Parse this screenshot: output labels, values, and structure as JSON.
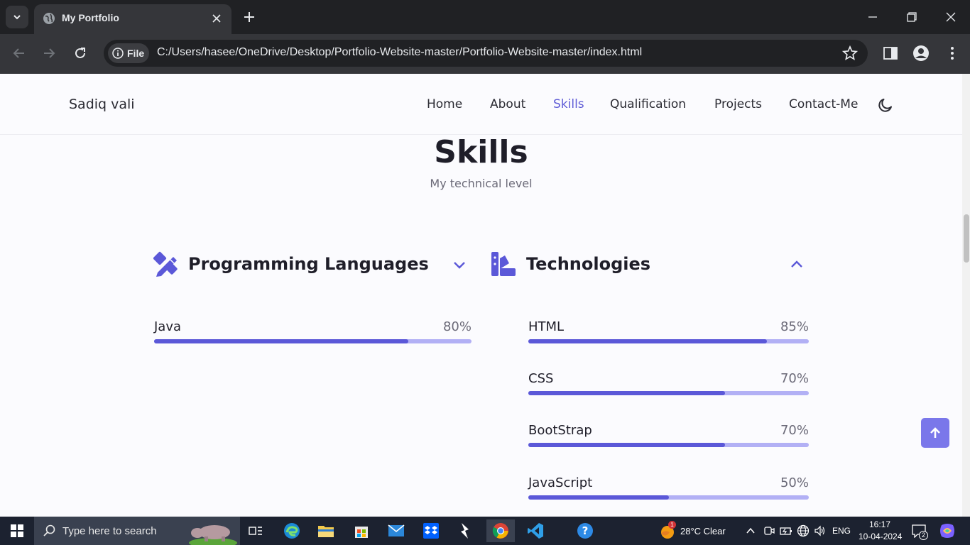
{
  "browser": {
    "tab_title": "My Portfolio",
    "site_info_label": "File",
    "url": "C:/Users/hasee/OneDrive/Desktop/Portfolio-Website-master/Portfolio-Website-master/index.html"
  },
  "header": {
    "logo": "Sadiq vali",
    "nav": [
      "Home",
      "About",
      "Skills",
      "Qualification",
      "Projects",
      "Contact-Me"
    ],
    "active_nav": "Skills"
  },
  "section": {
    "title": "Skills",
    "subtitle": "My technical level"
  },
  "skills": {
    "programming": {
      "title": "Programming Languages",
      "expanded": false,
      "items": [
        {
          "name": "Java",
          "percent_label": "80%",
          "value": 80
        }
      ]
    },
    "technologies": {
      "title": "Technologies",
      "expanded": true,
      "items": [
        {
          "name": "HTML",
          "percent_label": "85%",
          "value": 85
        },
        {
          "name": "CSS",
          "percent_label": "70%",
          "value": 70
        },
        {
          "name": "BootStrap",
          "percent_label": "70%",
          "value": 70
        },
        {
          "name": "JavaScript",
          "percent_label": "50%",
          "value": 50
        }
      ]
    }
  },
  "colors": {
    "accent": "#5b58d8",
    "bar_track": "#b2b0f5",
    "scroll_button": "#7a77ea"
  },
  "taskbar": {
    "search_placeholder": "Type here to search",
    "weather": "28°C  Clear",
    "language": "ENG",
    "time": "16:17",
    "date": "10-04-2024",
    "notification_count": "2",
    "weather_badge": "1"
  }
}
